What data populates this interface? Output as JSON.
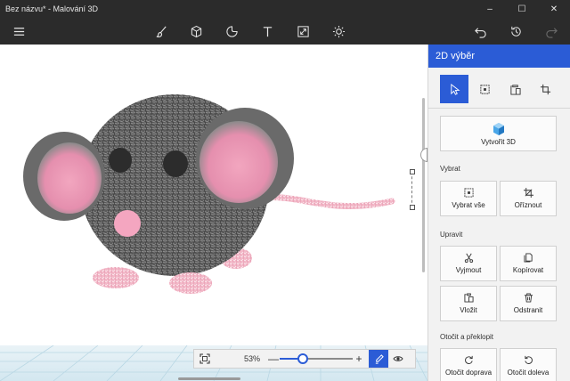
{
  "window": {
    "title": "Bez názvu* - Malování 3D",
    "minimize_glyph": "–",
    "maximize_glyph": "☐",
    "close_glyph": "✕"
  },
  "toolbar": {
    "menu_icon": "hamburger-menu-icon",
    "tools": [
      {
        "name": "brushes",
        "icon": "brush-icon"
      },
      {
        "name": "3d-shapes",
        "icon": "cube-icon"
      },
      {
        "name": "stickers",
        "icon": "sticker-icon"
      },
      {
        "name": "text",
        "icon": "text-icon"
      },
      {
        "name": "canvas",
        "icon": "canvas-resize-icon"
      },
      {
        "name": "effects",
        "icon": "sun-icon"
      }
    ],
    "right": [
      {
        "name": "undo",
        "icon": "undo-icon"
      },
      {
        "name": "history",
        "icon": "history-icon"
      },
      {
        "name": "redo",
        "icon": "redo-icon"
      }
    ]
  },
  "zoom": {
    "percent_label": "53%",
    "level": 0.53,
    "minus": "—",
    "plus": "+"
  },
  "panel": {
    "title": "2D výběr",
    "modes": [
      {
        "name": "select",
        "icon": "cursor-icon",
        "active": true
      },
      {
        "name": "area",
        "icon": "select-area-icon",
        "active": false
      },
      {
        "name": "clipboard",
        "icon": "clipboard-icon",
        "active": false
      },
      {
        "name": "crop",
        "icon": "crop-icon",
        "active": false
      }
    ],
    "create3d_label": "Vytvořit 3D",
    "sections": {
      "select": {
        "title": "Vybrat",
        "buttons": [
          {
            "label": "Vybrat vše",
            "icon": "select-all-icon"
          },
          {
            "label": "Oříznout",
            "icon": "crop-icon"
          }
        ]
      },
      "edit": {
        "title": "Upravit",
        "buttons": [
          {
            "label": "Vyjmout",
            "icon": "scissors-icon"
          },
          {
            "label": "Kopírovat",
            "icon": "copy-icon"
          },
          {
            "label": "Vložit",
            "icon": "paste-icon"
          },
          {
            "label": "Odstranit",
            "icon": "trash-icon"
          }
        ]
      },
      "rotate": {
        "title": "Otočit a překlopit",
        "buttons": [
          {
            "label": "Otočit doprava",
            "icon": "rotate-right-icon"
          },
          {
            "label": "Otočit doleva",
            "icon": "rotate-left-icon"
          }
        ]
      }
    }
  },
  "colors": {
    "accent": "#2b5cd6",
    "chrome_dark": "#2b2b2b",
    "panel_bg": "#f2f2f2"
  }
}
